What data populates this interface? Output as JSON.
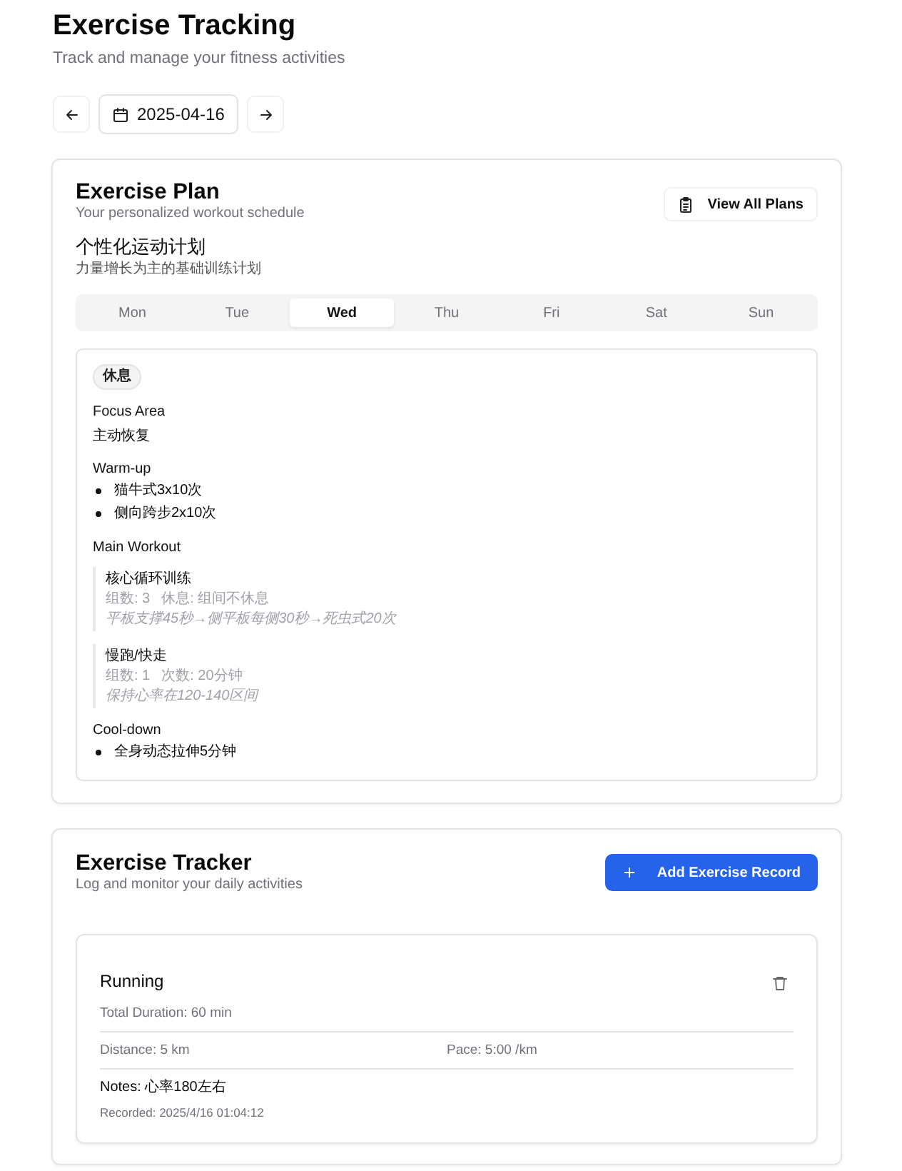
{
  "header": {
    "title": "Exercise Tracking",
    "subtitle": "Track and manage your fitness activities"
  },
  "date_nav": {
    "date": "2025-04-16"
  },
  "plan": {
    "title": "Exercise Plan",
    "subtitle": "Your personalized workout schedule",
    "button": "View All Plans",
    "plan_name": "个性化运动计划",
    "plan_description": "力量增长为主的基础训练计划",
    "days": [
      {
        "label": "Mon",
        "selected": false
      },
      {
        "label": "Tue",
        "selected": false
      },
      {
        "label": "Wed",
        "selected": true
      },
      {
        "label": "Thu",
        "selected": false
      },
      {
        "label": "Fri",
        "selected": false
      },
      {
        "label": "Sat",
        "selected": false
      },
      {
        "label": "Sun",
        "selected": false
      }
    ],
    "day_detail": {
      "badge": "休息",
      "focus_label": "Focus Area",
      "focus": "主动恢复",
      "warmup_label": "Warm-up",
      "warmup": [
        "猫牛式3x10次",
        "侧向跨步2x10次"
      ],
      "main_label": "Main Workout",
      "main": [
        {
          "name": "核心循环训练",
          "stats": [
            "组数: 3",
            "休息: 组间不休息"
          ],
          "notes": "平板支撑45秒→侧平板每侧30秒→死虫式20次"
        },
        {
          "name": "慢跑/快走",
          "stats": [
            "组数: 1",
            "次数: 20分钟"
          ],
          "notes": "保持心率在120-140区间"
        }
      ],
      "cooldown_label": "Cool-down",
      "cooldown": [
        "全身动态拉伸5分钟"
      ]
    }
  },
  "tracker": {
    "title": "Exercise Tracker",
    "subtitle": "Log and monitor your daily activities",
    "button": "Add Exercise Record",
    "records": [
      {
        "name": "Running",
        "duration": "Total Duration: 60 min",
        "details": [
          "Distance: 5 km",
          "Pace: 5:00 /km"
        ],
        "notes": "Notes: 心率180左右",
        "recorded": "Recorded: 2025/4/16 01:04:12"
      }
    ]
  }
}
